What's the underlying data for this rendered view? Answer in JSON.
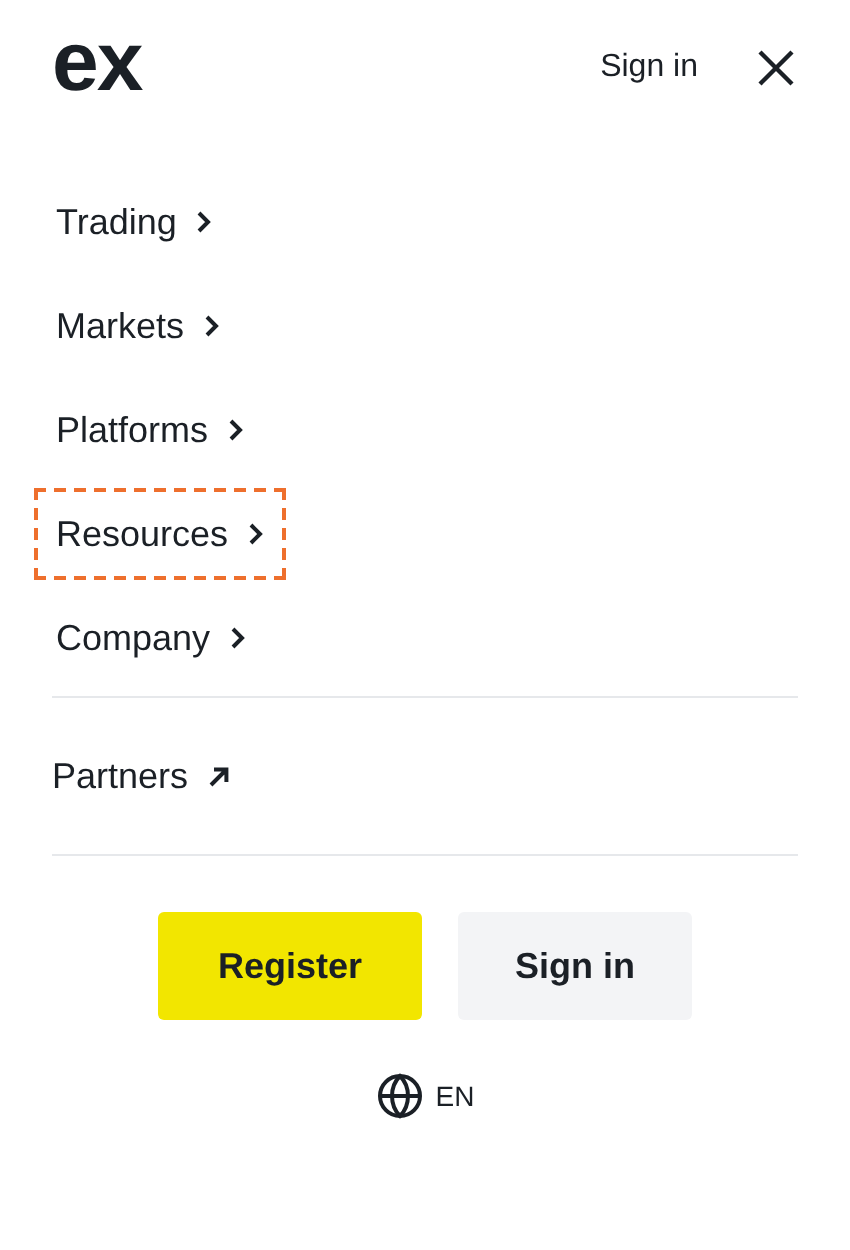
{
  "header": {
    "logo": "ex",
    "sign_in": "Sign in"
  },
  "menu": [
    {
      "label": "Trading",
      "focused": false
    },
    {
      "label": "Markets",
      "focused": false
    },
    {
      "label": "Platforms",
      "focused": false
    },
    {
      "label": "Resources",
      "focused": true
    },
    {
      "label": "Company",
      "focused": false
    }
  ],
  "partners": {
    "label": "Partners"
  },
  "buttons": [
    {
      "label": "Register",
      "kind": "primary"
    },
    {
      "label": "Sign in",
      "kind": "secondary"
    }
  ],
  "language": "EN"
}
